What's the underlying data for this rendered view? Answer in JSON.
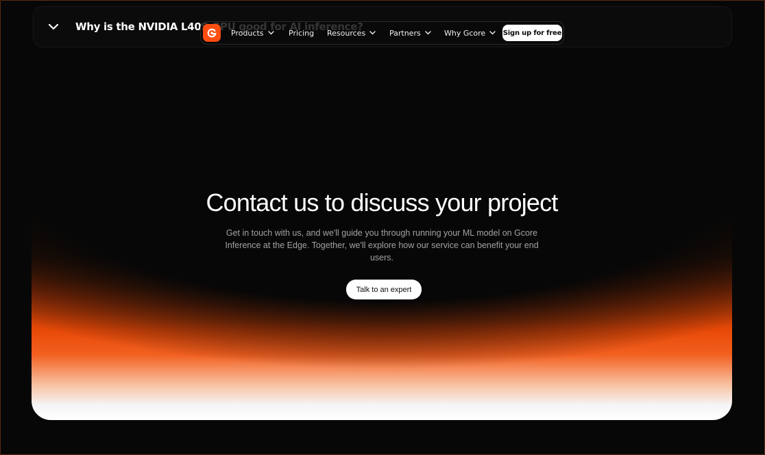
{
  "faq": {
    "title": "Why is the NVIDIA L40S GPU good for AI inference?",
    "chevron_icon": "chevron-down-icon"
  },
  "nav": {
    "logo_icon": "gcore-logo-icon",
    "brand_color": "#ff4d12",
    "items": [
      {
        "label": "Products",
        "has_dropdown": true
      },
      {
        "label": "Pricing",
        "has_dropdown": false
      },
      {
        "label": "Resources",
        "has_dropdown": true
      },
      {
        "label": "Partners",
        "has_dropdown": true
      },
      {
        "label": "Why Gcore",
        "has_dropdown": true
      }
    ],
    "signup_label": "Sign up for free"
  },
  "hero": {
    "title": "Contact us to discuss your project",
    "description": "Get in touch with us, and we'll guide you through running your ML model on Gcore Inference at the Edge. Together, we'll explore how our service can benefit your end users.",
    "cta_label": "Talk to an expert",
    "gradient_colors": [
      "#070707",
      "#e84a08",
      "#ffffff"
    ]
  }
}
